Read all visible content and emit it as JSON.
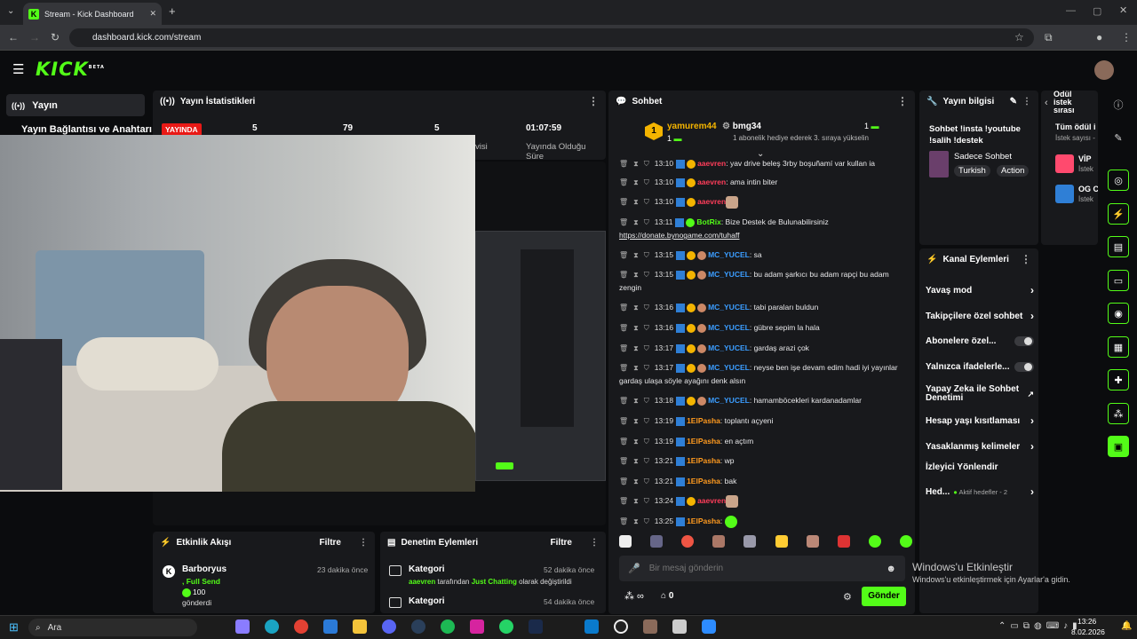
{
  "browser": {
    "tab_title": "Stream - Kick Dashboard",
    "url": "dashboard.kick.com/stream"
  },
  "kick": {
    "logo": "KICK",
    "beta": "BETA"
  },
  "left_nav": {
    "active": "Yayın",
    "sub": "Yayın Bağlantısı ve Anahtarı"
  },
  "stats": {
    "title": "Yayın İstatistikleri",
    "live_badge": "YAYINDA",
    "v1": "5",
    "v2": "79",
    "v3": "5",
    "time": "01:07:59",
    "time_label": "Yayında Olduğu Süre",
    "partial": "visi"
  },
  "events": {
    "title": "Etkinlik Akışı",
    "filter": "Filtre",
    "user": "Barboryus",
    "time": "23 dakika önce",
    "tier": ", Full Send",
    "amount": "100",
    "action": "gönderdi"
  },
  "moderation": {
    "title": "Denetim Eylemleri",
    "filter": "Filtre",
    "items": [
      {
        "label": "Kategori",
        "time": "52 dakika önce",
        "user": "aaevren",
        "mid": " tarafından ",
        "cat": "Just Chatting",
        "end": " olarak değiştirildi"
      },
      {
        "label": "Kategori",
        "time": "54 dakika önce"
      }
    ]
  },
  "chat": {
    "title": "Sohbet",
    "leader1": {
      "name": "yamurem44",
      "rank": "1",
      "count": "1"
    },
    "leader2": {
      "name": "bmg34",
      "count": "1",
      "note": "1 abonelik hediye ederek 3. sıraya yükselin"
    },
    "messages": [
      {
        "time": "13:10",
        "user": "aaevren",
        "cls": "u-red",
        "text": "yav drive beleş 3rby boşuñamí var kullan ia"
      },
      {
        "time": "13:10",
        "user": "aaevren",
        "cls": "u-red",
        "text": "ama intin biter"
      },
      {
        "time": "13:10",
        "user": "aaevren",
        "cls": "u-red",
        "text": ""
      },
      {
        "time": "13:11",
        "user": "BotRix",
        "cls": "u-green",
        "text": "Bize Destek de Bulunabilirsiniz",
        "link": "https://donate.bynogame.com/tuhaff"
      },
      {
        "time": "13:15",
        "user": "MC_YUCEL",
        "cls": "u-blue",
        "text": "sa"
      },
      {
        "time": "13:15",
        "user": "MC_YUCEL",
        "cls": "u-blue",
        "text": "bu adam şarkıcı bu adam rapçi bu adam zengin"
      },
      {
        "time": "13:16",
        "user": "MC_YUCEL",
        "cls": "u-blue",
        "text": "tabi paraları buldun"
      },
      {
        "time": "13:16",
        "user": "MC_YUCEL",
        "cls": "u-blue",
        "text": "gübre sepim la hala"
      },
      {
        "time": "13:17",
        "user": "MC_YUCEL",
        "cls": "u-blue",
        "text": "gardaş arazi çok"
      },
      {
        "time": "13:17",
        "user": "MC_YUCEL",
        "cls": "u-blue",
        "text": "neyse ben işe devam edim hadi iyi yayınlar gardaş ulaşa söyle ayağını denk alsın"
      },
      {
        "time": "13:18",
        "user": "MC_YUCEL",
        "cls": "u-blue",
        "text": "hamamböcekleri kardanadamlar"
      },
      {
        "time": "13:19",
        "user": "1ElPasha",
        "cls": "u-orange",
        "text": "toplantı açyeni"
      },
      {
        "time": "13:19",
        "user": "1ElPasha",
        "cls": "u-orange",
        "text": "en açtım"
      },
      {
        "time": "13:21",
        "user": "1ElPasha",
        "cls": "u-orange",
        "text": "wp"
      },
      {
        "time": "13:21",
        "user": "1ElPasha",
        "cls": "u-orange",
        "text": "bak"
      },
      {
        "time": "13:24",
        "user": "aaevren",
        "cls": "u-red",
        "text": ""
      },
      {
        "time": "13:25",
        "user": "1ElPasha",
        "cls": "u-orange",
        "text": ""
      }
    ],
    "placeholder": "Bir mesaj gönderin",
    "send": "Gönder",
    "points": "0"
  },
  "stream_info": {
    "title": "Yayın bilgisi",
    "stream_title": "Sohbet !insta !youtube !salih !destek",
    "mode": "Sadece Sohbet",
    "tags": [
      "Turkish",
      "Action"
    ]
  },
  "channel_actions": {
    "title": "Kanal Eylemleri",
    "items": [
      "Yavaş mod",
      "Takipçilere özel sohbet",
      "Abonelere özel...",
      "Yalnızca ifadelerle...",
      "Yapay Zeka ile Sohbet Denetimi",
      "Hesap yaşı kısıtlaması",
      "Yasaklanmış kelimeler",
      "İzleyici Yönlendir",
      "Hed..."
    ],
    "goals_note": "Aktif hedefler - 2"
  },
  "rewards": {
    "title": "Ödül istek sırası",
    "all": "Tüm ödül i",
    "count_label": "İstek sayısı -",
    "items": [
      {
        "name": "VİP",
        "sub": "İstek"
      },
      {
        "name": "OG C",
        "sub": "İstek"
      }
    ]
  },
  "windows": {
    "watermark1": "Windows'u Etkinleştir",
    "watermark2": "Windows'u etkinleştirmek için Ayarlar'a gidin.",
    "search": "Ara",
    "time": "13:26",
    "date": "8.02.2026"
  }
}
